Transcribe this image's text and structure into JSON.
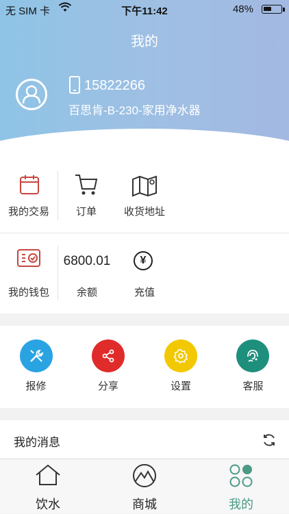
{
  "status": {
    "carrier": "无 SIM 卡",
    "time": "下午11:42",
    "battery_pct": "48%",
    "battery_level": 0.48
  },
  "header": {
    "title": "我的",
    "phone": "15822266",
    "device": "百思肯-B-230-家用净水器"
  },
  "quick": {
    "trade": "我的交易",
    "order": "订单",
    "address": "收货地址"
  },
  "wallet": {
    "label": "我的钱包",
    "amount": "6800.01",
    "balance_label": "余额",
    "recharge": "充值",
    "currency_symbol": "¥"
  },
  "services": [
    {
      "label": "报修",
      "color": "#2aa3e3",
      "icon": "wrench-icon"
    },
    {
      "label": "分享",
      "color": "#e02b2b",
      "icon": "share-icon"
    },
    {
      "label": "设置",
      "color": "#f2c800",
      "icon": "gear-icon"
    },
    {
      "label": "客服",
      "color": "#1f8f7d",
      "icon": "headset-icon"
    }
  ],
  "messages": {
    "title": "我的消息"
  },
  "tabs": [
    {
      "label": "饮水",
      "icon": "house-icon"
    },
    {
      "label": "商城",
      "icon": "mountain-icon"
    },
    {
      "label": "我的",
      "icon": "circles-icon",
      "active": true
    }
  ],
  "colors": {
    "accent": "#4a9a85",
    "header_start": "#8fc4e6",
    "header_end": "#a3b9e2"
  }
}
